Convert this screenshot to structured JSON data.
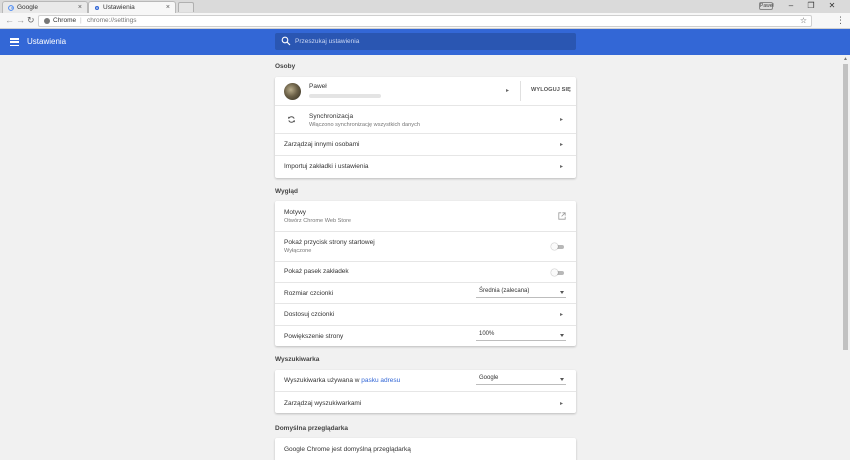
{
  "tabs": [
    {
      "title": "Google",
      "close": "×"
    },
    {
      "title": "Ustawienia",
      "close": "×"
    }
  ],
  "window": {
    "profile_badge": "Paweł",
    "minimize": "–",
    "maximize": "❐",
    "close": "✕"
  },
  "toolbar": {
    "back": "←",
    "forward": "→",
    "reload": "↻",
    "omnibox": {
      "scheme_label": "Chrome",
      "separator": "|",
      "url": "chrome://settings",
      "star": "☆"
    },
    "menu": "⋮"
  },
  "header": {
    "title": "Ustawienia",
    "search_placeholder": "Przeszukaj ustawienia"
  },
  "sections": {
    "people": {
      "title": "Osoby",
      "profile": {
        "name": "Paweł",
        "logout_label": "WYLOGUJ SIĘ"
      },
      "sync": {
        "title": "Synchronizacja",
        "subtitle": "Włączono synchronizację wszystkich danych"
      },
      "manage_people": "Zarządzaj innymi osobami",
      "import": "Importuj zakładki i ustawienia"
    },
    "appearance": {
      "title": "Wygląd",
      "themes": {
        "title": "Motywy",
        "subtitle": "Otwórz Chrome Web Store"
      },
      "home_button": {
        "title": "Pokaż przycisk strony startowej",
        "subtitle": "Wyłączone"
      },
      "bookmarks_bar": "Pokaż pasek zakładek",
      "font_size": {
        "label": "Rozmiar czcionki",
        "value": "Średnia (zalecana)"
      },
      "customize_fonts": "Dostosuj czcionki",
      "page_zoom": {
        "label": "Powiększenie strony",
        "value": "100%"
      }
    },
    "search_engine": {
      "title": "Wyszukiwarka",
      "label_prefix": "Wyszukiwarka używana w",
      "label_link": "pasku adresu",
      "value": "Google",
      "manage": "Zarządzaj wyszukiwarkami"
    },
    "default_browser": {
      "title": "Domyślna przeglądarka",
      "status": "Google Chrome jest domyślną przeglądarką"
    }
  },
  "arrow_glyph": "▸",
  "colors": {
    "header": "#3367d6",
    "search_bg": "#2a56b2",
    "background": "#f1f1f1",
    "link": "#3367d6"
  }
}
